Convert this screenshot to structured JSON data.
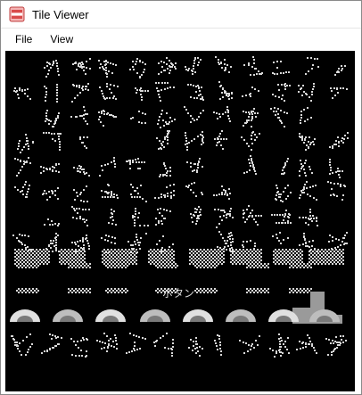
{
  "window": {
    "title": "Tile Viewer",
    "icon": "tile-viewer-app-icon"
  },
  "menu": {
    "items": [
      {
        "id": "file",
        "label": "File"
      },
      {
        "id": "view",
        "label": "View"
      }
    ]
  },
  "tile_view": {
    "background": "#000000",
    "foreground": "#d8d8d8",
    "columns": 16,
    "rows": 16,
    "visible_text": [
      "ボタン"
    ]
  }
}
